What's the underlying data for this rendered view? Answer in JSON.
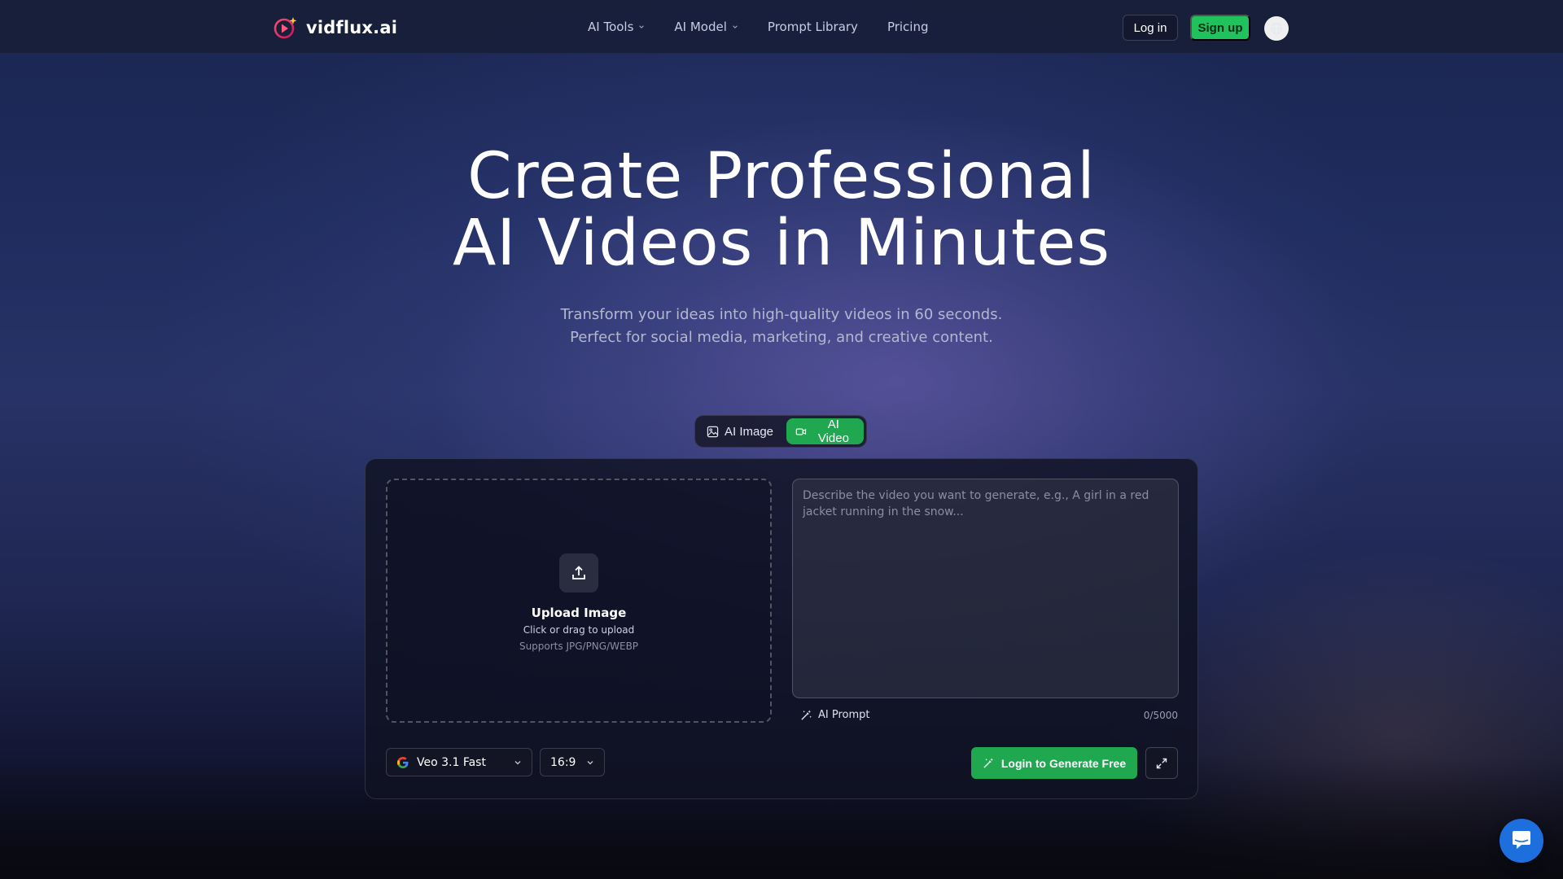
{
  "brand": {
    "name": "vidflux.ai"
  },
  "nav": {
    "links": [
      {
        "label": "AI Tools",
        "dropdown": true
      },
      {
        "label": "AI Model",
        "dropdown": true
      },
      {
        "label": "Prompt Library",
        "dropdown": false
      },
      {
        "label": "Pricing",
        "dropdown": false
      }
    ],
    "login": "Log in",
    "signup": "Sign up",
    "language_icon": "globe-icon"
  },
  "hero": {
    "title_line1": "Create Professional",
    "title_line2": "AI Videos in Minutes",
    "subtitle_line1": "Transform your ideas into high-quality videos in 60 seconds.",
    "subtitle_line2": "Perfect for social media, marketing, and creative content."
  },
  "mode_toggle": {
    "image_label": "AI Image",
    "video_label": "AI Video",
    "active": "AI Video"
  },
  "upload": {
    "title": "Upload Image",
    "hint": "Click or drag to upload",
    "formats": "Supports JPG/PNG/WEBP"
  },
  "prompt": {
    "placeholder": "Describe the video you want to generate, e.g., A girl in a red jacket running in the snow...",
    "value": "",
    "ai_prompt_label": "AI Prompt",
    "counter": "0/5000"
  },
  "controls": {
    "model": "Veo 3.1 Fast",
    "aspect_ratio": "16:9",
    "generate_label": "Login to Generate Free"
  },
  "colors": {
    "accent_green": "#1fa84f",
    "signup_green": "#1fc25d",
    "chat_blue": "#1e6fde"
  }
}
